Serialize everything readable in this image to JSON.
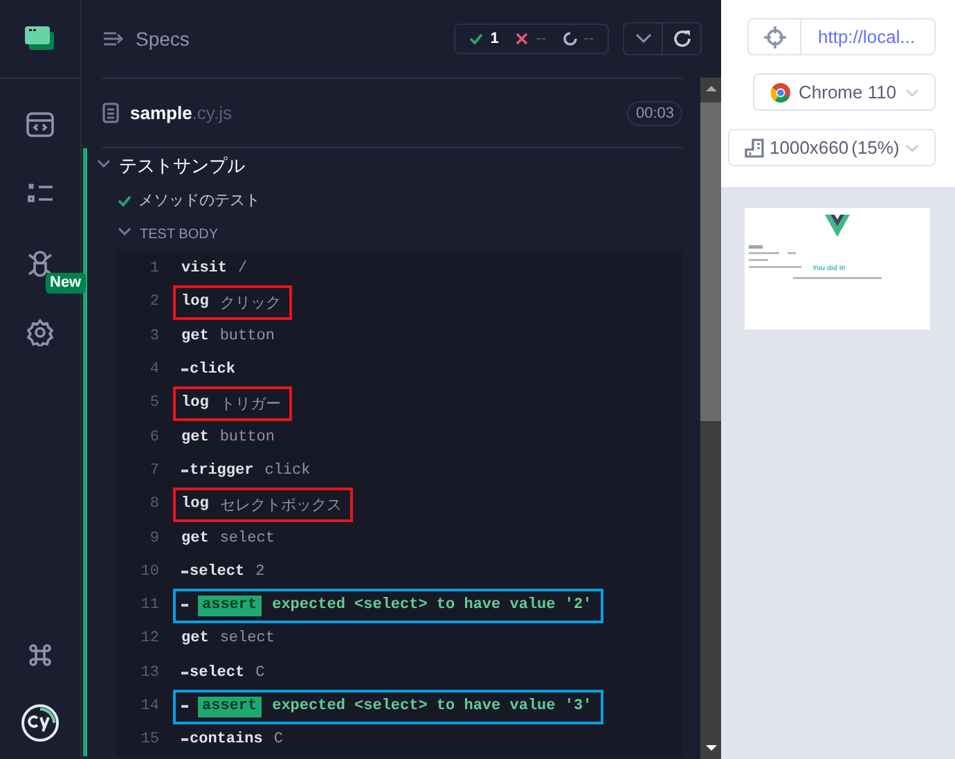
{
  "nav": {
    "badge": "New"
  },
  "header": {
    "title": "Specs",
    "stats": [
      {
        "kind": "passed",
        "count": "1"
      },
      {
        "kind": "failed",
        "count": "--"
      },
      {
        "kind": "pending",
        "count": "--"
      }
    ]
  },
  "spec": {
    "name": "sample",
    "extension": ".cy.js",
    "duration": "00:03"
  },
  "suite": {
    "title": "テストサンプル",
    "expanded": true,
    "tests": [
      {
        "title": "メソッドのテスト",
        "passed": true,
        "body": {
          "title": "TEST BODY",
          "expanded": true,
          "commands": [
            {
              "number": "1",
              "kind": "parent",
              "name": "visit",
              "message": "/"
            },
            {
              "number": "2",
              "kind": "parent",
              "name": "log",
              "message": "クリック",
              "color": "#e8151b"
            },
            {
              "number": "3",
              "kind": "parent",
              "name": "get",
              "message": "button"
            },
            {
              "number": "4",
              "kind": "child",
              "name": "click"
            },
            {
              "number": "5",
              "kind": "parent",
              "name": "log",
              "message": "トリガー",
              "color": "#e8151b"
            },
            {
              "number": "6",
              "kind": "parent",
              "name": "get",
              "message": "button"
            },
            {
              "number": "7",
              "kind": "child",
              "name": "trigger",
              "message": "click"
            },
            {
              "number": "8",
              "kind": "parent",
              "name": "log",
              "message": "セレクトボックス",
              "color": "#e8151b"
            },
            {
              "number": "9",
              "kind": "parent",
              "name": "get",
              "message": "select"
            },
            {
              "number": "10",
              "kind": "child",
              "name": "select",
              "message": "2"
            },
            {
              "number": "11",
              "kind": "assert",
              "name": "assert",
              "message": "expected <select> to have value '2'",
              "color": "#0a9de0"
            },
            {
              "number": "12",
              "kind": "parent",
              "name": "get",
              "message": "select"
            },
            {
              "number": "13",
              "kind": "child",
              "name": "select",
              "message": "C"
            },
            {
              "number": "14",
              "kind": "assert",
              "name": "assert",
              "message": "expected <select> to have value '3'",
              "color": "#0a9de0"
            },
            {
              "number": "15",
              "kind": "child",
              "name": "contains",
              "message": "C"
            }
          ]
        }
      }
    ]
  },
  "aside": {
    "url": "http://local...",
    "browser": "Chrome 110",
    "viewport": "1000x660",
    "scale": "(15%)",
    "preview": {
      "heading": "You did it!"
    }
  }
}
